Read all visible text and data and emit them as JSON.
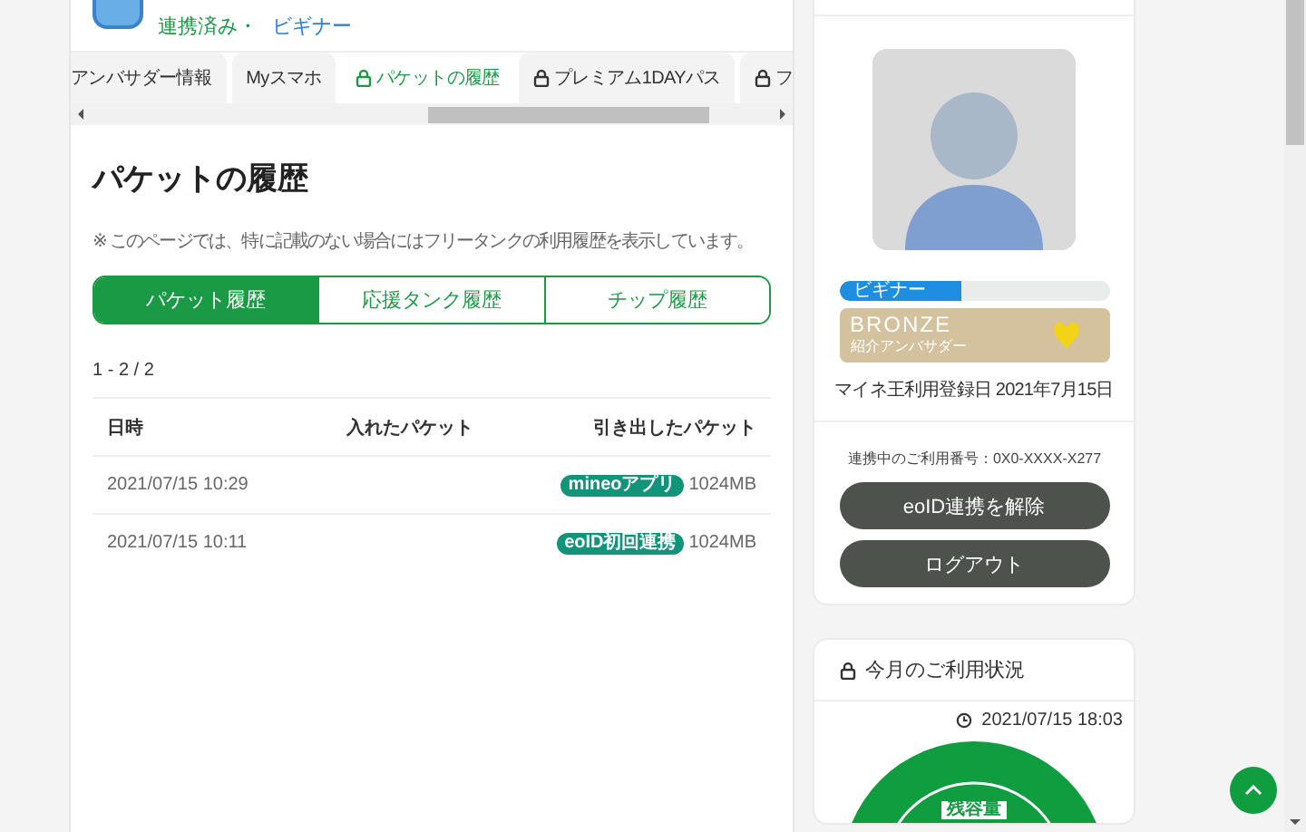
{
  "account": {
    "status": "連携済み・",
    "rank_link": "ビギナー"
  },
  "tabs": [
    {
      "label": "アンバサダー情報",
      "locked": false,
      "selected": false
    },
    {
      "label": "Myスマホ",
      "locked": false,
      "selected": false
    },
    {
      "label": "パケットの履歴",
      "locked": true,
      "selected": true
    },
    {
      "label": "プレミアム1DAYパス",
      "locked": true,
      "selected": false
    },
    {
      "label": "フ",
      "locked": true,
      "selected": false
    }
  ],
  "page": {
    "title": "パケットの履歴",
    "note": "※ このページでは、特に記載のない場合にはフリータンクの利用履歴を表示しています。"
  },
  "history_tabs": [
    {
      "label": "パケット履歴",
      "selected": true
    },
    {
      "label": "応援タンク履歴",
      "selected": false
    },
    {
      "label": "チップ履歴",
      "selected": false
    }
  ],
  "count": "1 - 2 / 2",
  "table": {
    "columns": [
      "日時",
      "入れたパケット",
      "引き出したパケット"
    ],
    "rows": [
      {
        "date": "2021/07/15 10:29",
        "badge": "mineoアプリ",
        "withdrawn": "1024MB"
      },
      {
        "date": "2021/07/15 10:11",
        "badge": "eoID初回連携",
        "withdrawn": "1024MB"
      }
    ]
  },
  "profile": {
    "rank": {
      "label": "ビギナー",
      "level": 0.45
    },
    "badge": {
      "title": "BRONZE",
      "subtitle": "紹介アンバサダー"
    },
    "registered": "マイネ王利用登録日 2021年7月15日",
    "linked_number": "連携中のご利用番号：0X0-XXXX-X277",
    "buttons": [
      "eoID連携を解除",
      "ログアウト"
    ]
  },
  "usage": {
    "title": "今月のご利用状況",
    "updated": "2021/07/15 18:03",
    "donut_label": "残容量"
  }
}
